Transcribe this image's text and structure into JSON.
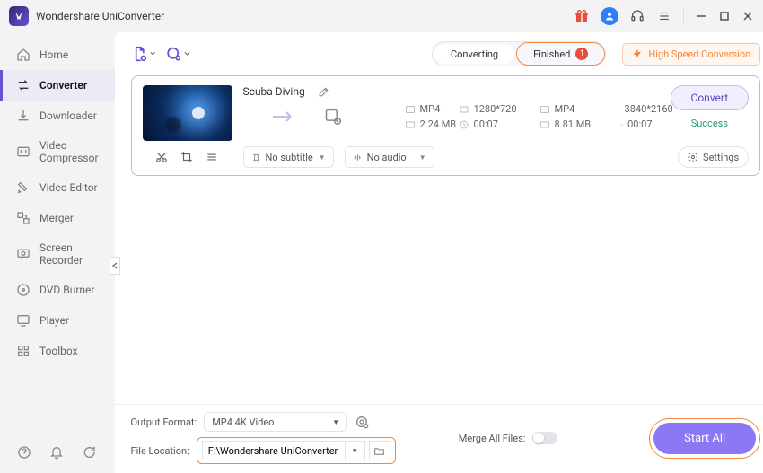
{
  "app": {
    "title": "Wondershare UniConverter"
  },
  "titlebar": {
    "gift": "gift",
    "avatar": "user"
  },
  "sidebar": {
    "items": [
      {
        "label": "Home",
        "icon": "home"
      },
      {
        "label": "Converter",
        "icon": "converter",
        "active": true
      },
      {
        "label": "Downloader",
        "icon": "download"
      },
      {
        "label": "Video Compressor",
        "icon": "compressor"
      },
      {
        "label": "Video Editor",
        "icon": "editor"
      },
      {
        "label": "Merger",
        "icon": "merger"
      },
      {
        "label": "Screen Recorder",
        "icon": "recorder"
      },
      {
        "label": "DVD Burner",
        "icon": "dvd"
      },
      {
        "label": "Player",
        "icon": "player"
      },
      {
        "label": "Toolbox",
        "icon": "toolbox"
      }
    ]
  },
  "topbar": {
    "tabs": {
      "converting": "Converting",
      "finished": "Finished",
      "finished_count": "1"
    },
    "high_speed": "High Speed Conversion"
  },
  "file": {
    "title": "Scuba Diving -",
    "src": {
      "format": "MP4",
      "resolution": "1280*720",
      "size": "2.24 MB",
      "duration": "00:07"
    },
    "dst": {
      "format": "MP4",
      "resolution": "3840*2160",
      "size": "8.81 MB",
      "duration": "00:07"
    },
    "subtitle": "No subtitle",
    "audio": "No audio",
    "settings": "Settings",
    "convert": "Convert",
    "status": "Success"
  },
  "footer": {
    "output_label": "Output Format:",
    "output_value": "MP4 4K Video",
    "location_label": "File Location:",
    "location_value": "F:\\Wondershare UniConverter",
    "merge_label": "Merge All Files:",
    "start_all": "Start All"
  }
}
